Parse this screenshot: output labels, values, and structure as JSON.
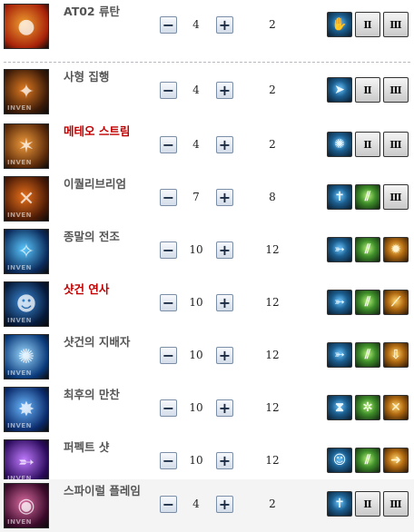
{
  "skills": [
    {
      "name": "AT02 류탄",
      "red": false,
      "value": "4",
      "level": "2",
      "thumb_colors": [
        "#a8230a",
        "#f0a030"
      ],
      "thumb_glyph": "●",
      "watermark": "",
      "slots": [
        {
          "type": "icon",
          "tone": "icon",
          "glyph": "✋"
        },
        {
          "type": "roman",
          "tone": "roman",
          "glyph": "Ⅱ"
        },
        {
          "type": "roman",
          "tone": "roman",
          "glyph": "Ⅲ"
        }
      ]
    },
    {
      "name": "사형 집행",
      "red": false,
      "value": "4",
      "level": "2",
      "thumb_colors": [
        "#3a1a08",
        "#e07a20"
      ],
      "thumb_glyph": "✦",
      "watermark": "INVEN",
      "slots": [
        {
          "type": "icon",
          "tone": "icon",
          "glyph": "➤"
        },
        {
          "type": "roman",
          "tone": "roman",
          "glyph": "Ⅱ"
        },
        {
          "type": "roman",
          "tone": "roman",
          "glyph": "Ⅲ"
        }
      ]
    },
    {
      "name": "메테오 스트림",
      "red": true,
      "value": "4",
      "level": "2",
      "thumb_colors": [
        "#5a2a0a",
        "#f09a3a"
      ],
      "thumb_glyph": "✶",
      "watermark": "INVEN",
      "slots": [
        {
          "type": "icon",
          "tone": "icon",
          "glyph": "✺"
        },
        {
          "type": "roman",
          "tone": "roman",
          "glyph": "Ⅱ"
        },
        {
          "type": "roman",
          "tone": "roman",
          "glyph": "Ⅲ"
        }
      ]
    },
    {
      "name": "이퀄리브리엄",
      "red": false,
      "value": "7",
      "level": "8",
      "thumb_colors": [
        "#4a1a06",
        "#e8701a"
      ],
      "thumb_glyph": "✕",
      "watermark": "INVEN",
      "slots": [
        {
          "type": "icon",
          "tone": "icon",
          "glyph": "✝"
        },
        {
          "type": "icon",
          "tone": "green",
          "glyph": "⫽"
        },
        {
          "type": "roman",
          "tone": "roman",
          "glyph": "Ⅲ"
        }
      ]
    },
    {
      "name": "종말의 전조",
      "red": false,
      "value": "10",
      "level": "12",
      "thumb_colors": [
        "#0a2a5a",
        "#5ac8ff"
      ],
      "thumb_glyph": "✧",
      "watermark": "INVEN",
      "slots": [
        {
          "type": "icon",
          "tone": "icon",
          "glyph": "➳"
        },
        {
          "type": "icon",
          "tone": "green",
          "glyph": "⫽"
        },
        {
          "type": "icon",
          "tone": "gold",
          "glyph": "✹"
        }
      ]
    },
    {
      "name": "샷건 연사",
      "red": true,
      "value": "10",
      "level": "12",
      "thumb_colors": [
        "#061a3a",
        "#3a8ad8"
      ],
      "thumb_glyph": "☻",
      "watermark": "INVEN",
      "slots": [
        {
          "type": "icon",
          "tone": "icon",
          "glyph": "➳"
        },
        {
          "type": "icon",
          "tone": "green",
          "glyph": "⫽"
        },
        {
          "type": "icon",
          "tone": "gold",
          "glyph": "⟋"
        }
      ]
    },
    {
      "name": "샷건의 지배자",
      "red": false,
      "value": "10",
      "level": "12",
      "thumb_colors": [
        "#0a3a7a",
        "#9ad8ff"
      ],
      "thumb_glyph": "✺",
      "watermark": "INVEN",
      "slots": [
        {
          "type": "icon",
          "tone": "icon",
          "glyph": "➳"
        },
        {
          "type": "icon",
          "tone": "green",
          "glyph": "⫽"
        },
        {
          "type": "icon",
          "tone": "gold",
          "glyph": "⇩"
        }
      ]
    },
    {
      "name": "최후의 만찬",
      "red": false,
      "value": "10",
      "level": "12",
      "thumb_colors": [
        "#0a2a6a",
        "#6ab8ff"
      ],
      "thumb_glyph": "✸",
      "watermark": "INVEN",
      "slots": [
        {
          "type": "icon",
          "tone": "icon",
          "glyph": "⧗"
        },
        {
          "type": "icon",
          "tone": "green",
          "glyph": "✲"
        },
        {
          "type": "icon",
          "tone": "gold",
          "glyph": "✕"
        }
      ]
    },
    {
      "name": "퍼펙트 샷",
      "red": false,
      "value": "10",
      "level": "12",
      "thumb_colors": [
        "#2a0a5a",
        "#c07aff"
      ],
      "thumb_glyph": "➵",
      "watermark": "INVEN",
      "slots": [
        {
          "type": "icon",
          "tone": "icon",
          "glyph": "☺"
        },
        {
          "type": "icon",
          "tone": "green",
          "glyph": "⫽"
        },
        {
          "type": "icon",
          "tone": "gold",
          "glyph": "➜"
        }
      ]
    },
    {
      "name": "스파이럴 플레임",
      "red": false,
      "value": "4",
      "level": "2",
      "thumb_colors": [
        "#3a0a2a",
        "#d86aa0"
      ],
      "thumb_glyph": "◉",
      "watermark": "INVEN",
      "slots": [
        {
          "type": "icon",
          "tone": "icon",
          "glyph": "✝"
        },
        {
          "type": "roman",
          "tone": "roman",
          "glyph": "Ⅱ"
        },
        {
          "type": "roman",
          "tone": "roman",
          "glyph": "Ⅲ"
        }
      ]
    }
  ],
  "controls": {
    "minus": "−",
    "plus": "+"
  }
}
